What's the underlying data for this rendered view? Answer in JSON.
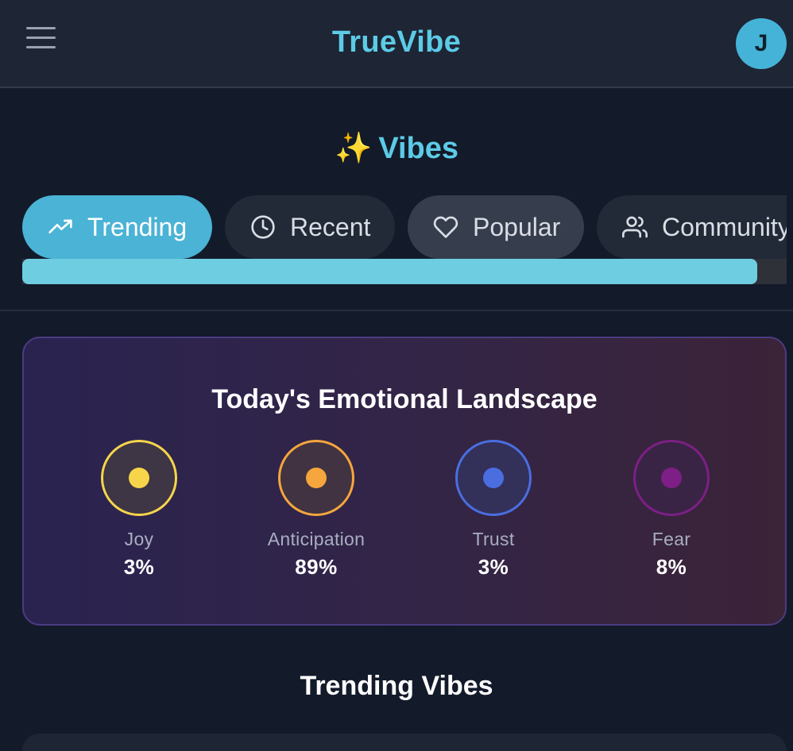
{
  "header": {
    "title": "TrueVibe",
    "avatar_initial": "J"
  },
  "section": {
    "icon": "sparkles-icon",
    "spark_glyph": "✨",
    "title": "Vibes"
  },
  "tabs": [
    {
      "label": "Trending",
      "icon": "trending-up-icon",
      "active": true
    },
    {
      "label": "Recent",
      "icon": "clock-icon",
      "active": false
    },
    {
      "label": "Popular",
      "icon": "heart-icon",
      "active": false
    },
    {
      "label": "Community",
      "icon": "users-icon",
      "active": false
    }
  ],
  "emotional_landscape": {
    "title": "Today's Emotional Landscape",
    "emotions": [
      {
        "label": "Joy",
        "value": "3%",
        "color": "#f7d54a"
      },
      {
        "label": "Anticipation",
        "value": "89%",
        "color": "#f5a63c"
      },
      {
        "label": "Trust",
        "value": "3%",
        "color": "#4a6ee0"
      },
      {
        "label": "Fear",
        "value": "8%",
        "color": "#7d1f86"
      }
    ]
  },
  "feed": {
    "title": "Trending Vibes"
  },
  "colors": {
    "accent": "#5ccbe6",
    "background": "#131a2a",
    "header": "#1e2534"
  }
}
